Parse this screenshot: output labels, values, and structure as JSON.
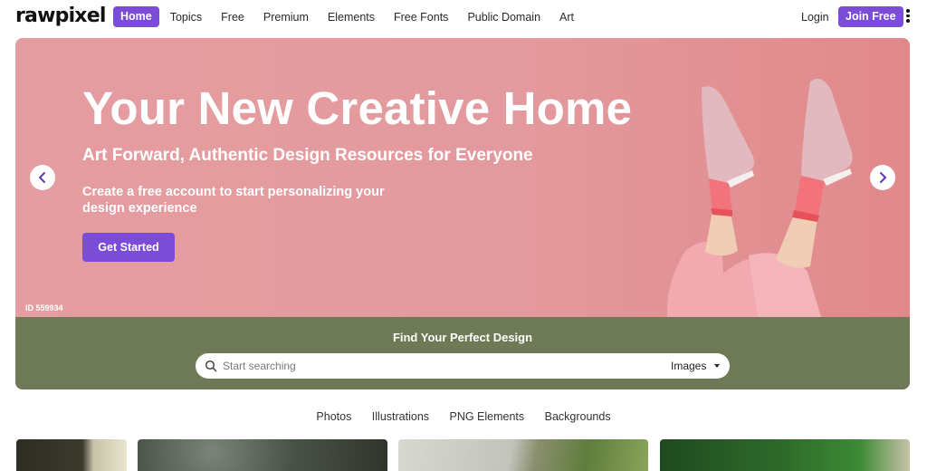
{
  "brand": {
    "logo_text": "rawpixel",
    "accent": "#7b4cd8"
  },
  "nav": {
    "items": [
      {
        "label": "Home",
        "active": true
      },
      {
        "label": "Topics"
      },
      {
        "label": "Free"
      },
      {
        "label": "Premium"
      },
      {
        "label": "Elements"
      },
      {
        "label": "Free Fonts"
      },
      {
        "label": "Public Domain"
      },
      {
        "label": "Art"
      }
    ],
    "login_label": "Login",
    "join_label": "Join Free",
    "more_icon": "vertical-dots-icon"
  },
  "hero": {
    "title": "Your New Creative Home",
    "subtitle": "Art Forward, Authentic Design Resources for Everyone",
    "description": "Create a free account to start personalizing your design experience",
    "cta_label": "Get Started",
    "image_id": "ID 559934",
    "background_color": "#e49da0",
    "prev_icon": "chevron-left-icon",
    "next_icon": "chevron-right-icon"
  },
  "search": {
    "heading": "Find Your Perfect Design",
    "placeholder": "Start searching",
    "value": "",
    "type_selected": "Images",
    "band_color": "#6e7a55"
  },
  "categories": [
    "Photos",
    "Illustrations",
    "PNG Elements",
    "Backgrounds"
  ]
}
